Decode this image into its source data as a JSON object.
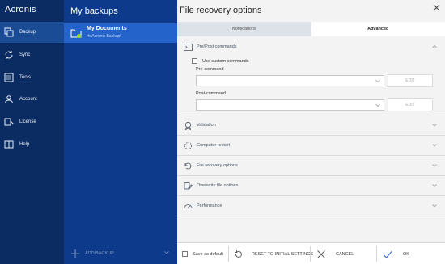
{
  "app": {
    "logo": "Acronis"
  },
  "nav": {
    "items": [
      {
        "label": "Backup",
        "icon": "backup-icon",
        "active": true
      },
      {
        "label": "Sync",
        "icon": "sync-icon"
      },
      {
        "label": "Tools",
        "icon": "tools-icon"
      },
      {
        "label": "Account",
        "icon": "account-icon"
      },
      {
        "label": "License",
        "icon": "license-icon"
      },
      {
        "label": "Help",
        "icon": "help-icon"
      }
    ]
  },
  "backups": {
    "title": "My backups",
    "selected": {
      "name": "My Documents",
      "path": "H:\\Acronis Backup\\",
      "icon": "folder-icon"
    },
    "add_label": "ADD BACKUP"
  },
  "panel": {
    "title": "File recovery options",
    "tabs": [
      {
        "label": "Notifications",
        "active": false
      },
      {
        "label": "Advanced",
        "active": true
      }
    ],
    "prepost": {
      "title": "Pre/Post commands",
      "use_custom": "Use custom commands",
      "pre_label": "Pre-command",
      "post_label": "Post-command",
      "edit_label": "EDIT"
    },
    "sections": [
      {
        "title": "Validation",
        "icon": "validation-icon"
      },
      {
        "title": "Computer restart",
        "icon": "restart-icon"
      },
      {
        "title": "File recovery options",
        "icon": "file-recovery-icon"
      },
      {
        "title": "Overwrite file options",
        "icon": "overwrite-icon"
      },
      {
        "title": "Performance",
        "icon": "performance-icon"
      }
    ]
  },
  "footer": {
    "save_default": "Save as default",
    "reset": "RESET TO INITIAL SETTINGS",
    "cancel": "CANCEL",
    "ok": "OK"
  },
  "colors": {
    "accent": "#2463c9",
    "nav_bg": "#0b2c62",
    "list_bg": "#0d3a8a"
  }
}
